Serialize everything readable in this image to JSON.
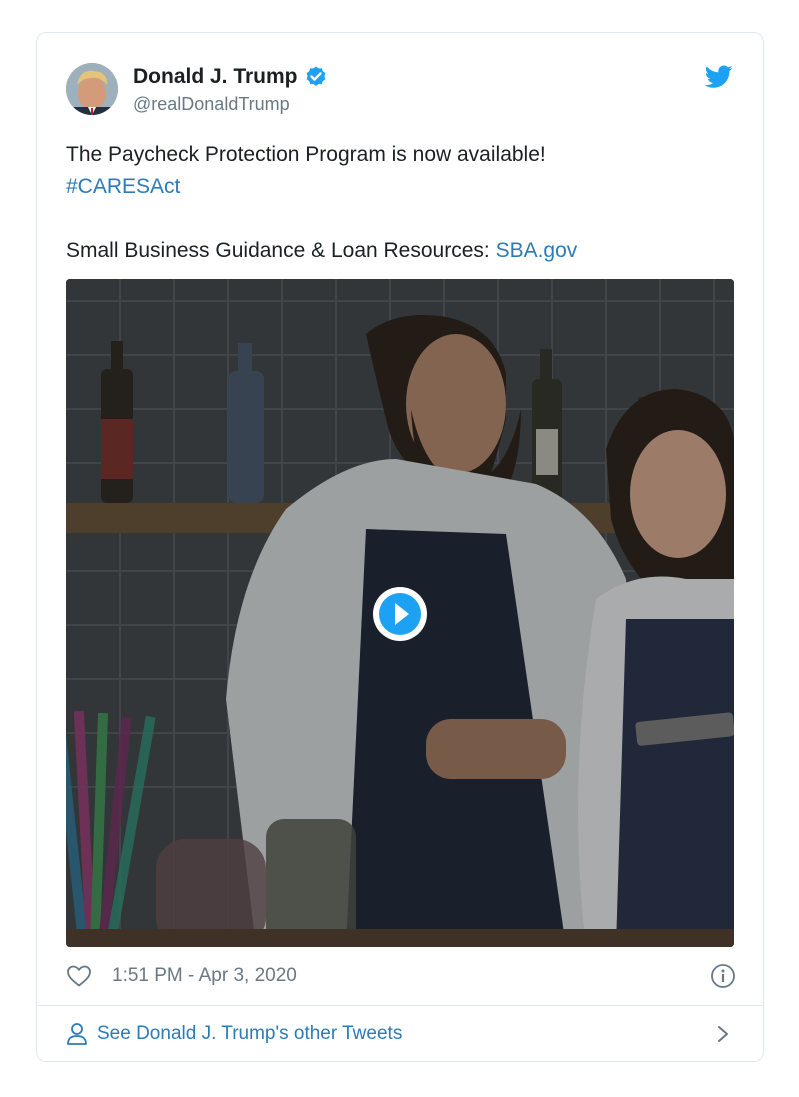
{
  "tweet": {
    "author_name": "Donald J. Trump",
    "author_handle": "@realDonaldTrump",
    "line1": "The Paycheck Protection Program is now available!",
    "hashtag": "#CARESAct",
    "line3_prefix": "Small Business Guidance & Loan Resources: ",
    "line3_link": "SBA.gov",
    "timestamp": "1:51 PM - Apr 3, 2020"
  },
  "footer": {
    "see_more_label": "See Donald J. Trump's other Tweets"
  },
  "icons": {
    "verified": "verified-badge-icon",
    "brand": "twitter-bird-icon",
    "play": "play-icon",
    "like": "heart-icon",
    "info": "info-icon",
    "profile": "person-icon",
    "chevron": "chevron-right-icon"
  },
  "colors": {
    "link": "#2b7bb9",
    "verified": "#1da1f2",
    "muted": "#697882",
    "border": "#e1e8ed"
  }
}
